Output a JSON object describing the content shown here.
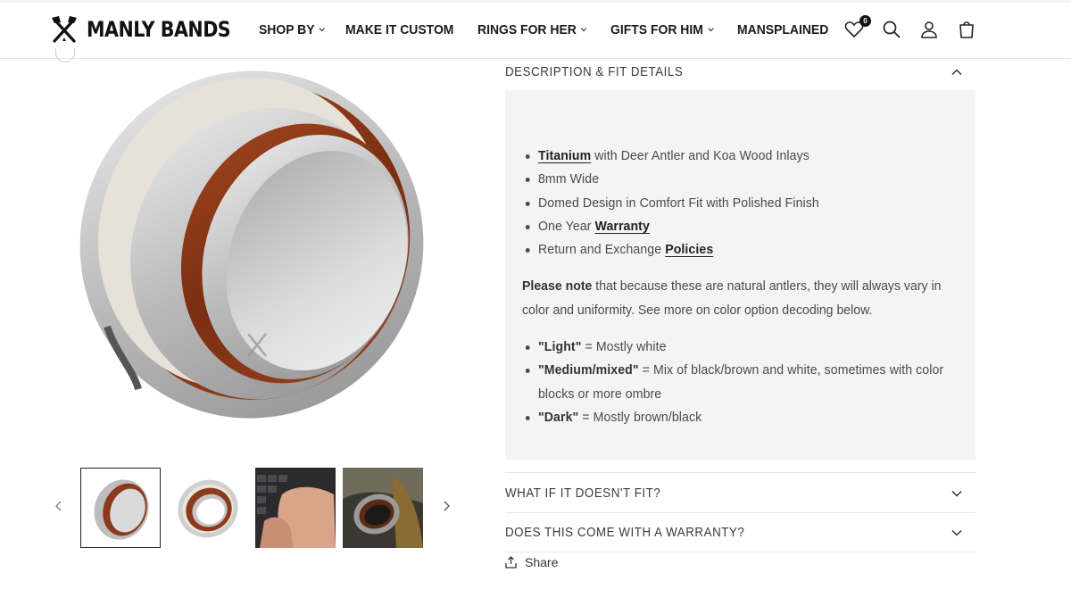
{
  "brand": {
    "name": "MANLY BANDS"
  },
  "nav": {
    "items": [
      {
        "label": "SHOP BY",
        "dropdown": true
      },
      {
        "label": "MAKE IT CUSTOM",
        "dropdown": false
      },
      {
        "label": "RINGS FOR HER",
        "dropdown": true
      },
      {
        "label": "GIFTS FOR HIM",
        "dropdown": true
      },
      {
        "label": "MANSPLAINED",
        "dropdown": false
      }
    ]
  },
  "header_icons": {
    "wishlist_count": "0",
    "icons": [
      "heart-icon",
      "search-icon",
      "account-icon",
      "cart-icon"
    ]
  },
  "gallery": {
    "thumbnails": [
      "ring-side-view",
      "ring-front-view",
      "hands-typing-laptop",
      "ring-on-rock"
    ],
    "active_index": 0
  },
  "accordion": {
    "description_title": "DESCRIPTION & FIT DETAILS",
    "features": {
      "f1_link": "Titanium",
      "f1_rest": " with Deer Antler and Koa Wood Inlays",
      "f2": "8mm Wide",
      "f3": "Domed Design in Comfort Fit with Polished Finish",
      "f4_text": "One Year ",
      "f4_link": "Warranty",
      "f5_text": "Return and Exchange ",
      "f5_link": "Policies"
    },
    "note": {
      "bold": "Please note",
      "text": " that because these are natural antlers, they will always vary in color and uniformity. See more on color option decoding below."
    },
    "colors": {
      "c1_name": "\"Light\"",
      "c1_desc": " = Mostly white",
      "c2_name": "\"Medium/mixed\"",
      "c2_desc": " = Mix of black/brown and white, sometimes with color blocks or more ombre",
      "c3_name": "\"Dark\"",
      "c3_desc": " = Mostly brown/black"
    },
    "fit_title": "WHAT IF IT DOESN'T FIT?",
    "warranty_title": "DOES THIS COME WITH A WARRANTY?"
  },
  "share": {
    "label": "Share"
  },
  "colors": {
    "text": "#121212",
    "panel_bg": "#f4f4f4",
    "wood": "#8b3a1c",
    "antler": "#e8e5de",
    "titanium": "#c9c9c9"
  }
}
